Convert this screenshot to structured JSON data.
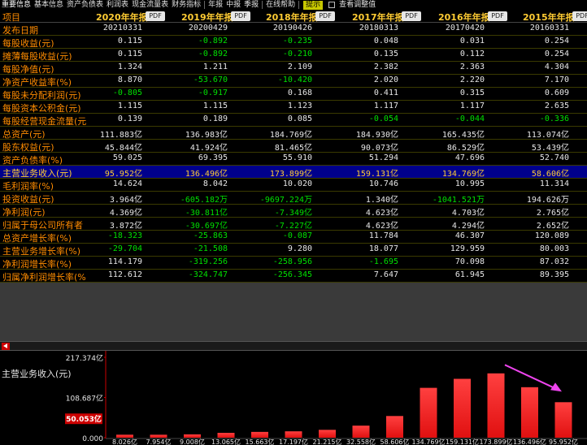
{
  "menu": {
    "items": [
      "重要信息",
      "基本信息",
      "资产负债表",
      "利润表",
      "现金流量表",
      "财务指标"
    ],
    "period_items": [
      "年报",
      "中报",
      "季报"
    ],
    "help": "在线帮助",
    "hint": "提示",
    "checkbox_label": "查看调整值"
  },
  "header": {
    "first_col": "项目",
    "pdf_label": "PDF",
    "years": [
      "2020年年报",
      "2019年年报",
      "2018年年报",
      "2017年年报",
      "2016年年报",
      "2015年年报"
    ]
  },
  "rows": [
    {
      "label": "发布日期",
      "values": [
        "20210331",
        "20200429",
        "20190426",
        "20180313",
        "20170420",
        "20160331"
      ]
    },
    {
      "label": "每股收益(元)",
      "values": [
        "0.115",
        "-0.892",
        "-0.235",
        "0.048",
        "0.031",
        "0.254"
      ]
    },
    {
      "label": "摊薄每股收益(元)",
      "values": [
        "0.115",
        "-0.892",
        "-0.210",
        "0.135",
        "0.112",
        "0.254"
      ]
    },
    {
      "label": "每股净值(元)",
      "values": [
        "1.324",
        "1.211",
        "2.109",
        "2.382",
        "2.363",
        "4.304"
      ]
    },
    {
      "label": "净资产收益率(%)",
      "values": [
        "8.870",
        "-53.670",
        "-10.420",
        "2.020",
        "2.220",
        "7.170"
      ]
    },
    {
      "label": "每股未分配利润(元)",
      "values": [
        "-0.805",
        "-0.917",
        "0.168",
        "0.411",
        "0.315",
        "0.609"
      ]
    },
    {
      "label": "每股资本公积金(元)",
      "values": [
        "1.115",
        "1.115",
        "1.123",
        "1.117",
        "1.117",
        "2.635"
      ]
    },
    {
      "label": "每股经营现金流量(元",
      "values": [
        "0.139",
        "0.189",
        "0.085",
        "-0.054",
        "-0.044",
        "-0.336"
      ]
    },
    {
      "label": "总资产(元)",
      "values": [
        "111.883亿",
        "136.983亿",
        "184.769亿",
        "184.930亿",
        "165.435亿",
        "113.074亿"
      ]
    },
    {
      "label": "股东权益(元)",
      "values": [
        "45.844亿",
        "41.924亿",
        "81.465亿",
        "90.073亿",
        "86.529亿",
        "53.439亿"
      ]
    },
    {
      "label": "资产负债率(%)",
      "values": [
        "59.025",
        "69.395",
        "55.910",
        "51.294",
        "47.696",
        "52.740"
      ]
    },
    {
      "label": "主营业务收入(元)",
      "values": [
        "95.952亿",
        "136.496亿",
        "173.899亿",
        "159.131亿",
        "134.769亿",
        "58.606亿"
      ],
      "highlight": true
    },
    {
      "label": "毛利润率(%)",
      "values": [
        "14.624",
        "8.042",
        "10.020",
        "10.746",
        "10.995",
        "11.314"
      ]
    },
    {
      "label": "投资收益(元)",
      "values": [
        "3.964亿",
        "-605.182万",
        "-9697.224万",
        "1.340亿",
        "-1041.521万",
        "194.626万"
      ]
    },
    {
      "label": "净利润(元)",
      "values": [
        "4.369亿",
        "-30.811亿",
        "-7.349亿",
        "4.623亿",
        "4.703亿",
        "2.765亿"
      ]
    },
    {
      "label": "归属于母公司所有者",
      "values": [
        "3.872亿",
        "-30.697亿",
        "-7.227亿",
        "4.623亿",
        "4.294亿",
        "2.652亿"
      ]
    },
    {
      "label": "总资产增长率(%)",
      "values": [
        "-18.323",
        "-25.863",
        "-0.087",
        "11.784",
        "46.307",
        "120.089"
      ]
    },
    {
      "label": "主营业务增长率(%)",
      "values": [
        "-29.704",
        "-21.508",
        "9.280",
        "18.077",
        "129.959",
        "80.003"
      ]
    },
    {
      "label": "净利润增长率(%)",
      "values": [
        "114.179",
        "-319.256",
        "-258.956",
        "-1.695",
        "70.098",
        "87.032"
      ]
    },
    {
      "label": "归属净利润增长率(%",
      "values": [
        "112.612",
        "-324.747",
        "-256.345",
        "7.647",
        "61.945",
        "89.395"
      ]
    }
  ],
  "chart_data": {
    "type": "bar",
    "title": "主营业务收入(元)",
    "y_ticks": [
      "217.374亿",
      "108.687亿",
      "0.000"
    ],
    "current_value_label": "50.053亿",
    "ylim": [
      0,
      217.374
    ],
    "categories": [
      "8.026亿",
      "7.954亿",
      "9.008亿",
      "13.065亿",
      "15.663亿",
      "17.197亿",
      "21.215亿",
      "32.558亿",
      "58.606亿",
      "134.769亿",
      "159.131亿",
      "173.899亿",
      "136.496亿",
      "95.952亿"
    ],
    "values": [
      8.026,
      7.954,
      9.008,
      13.065,
      15.663,
      17.197,
      21.215,
      32.558,
      58.606,
      134.769,
      159.131,
      173.899,
      136.496,
      95.952
    ],
    "colors": {
      "bar": "#e01010",
      "bar_top": "#ff4040",
      "arrow": "#ee44ee",
      "axis": "#cc0000",
      "current": "#cc0000"
    }
  }
}
